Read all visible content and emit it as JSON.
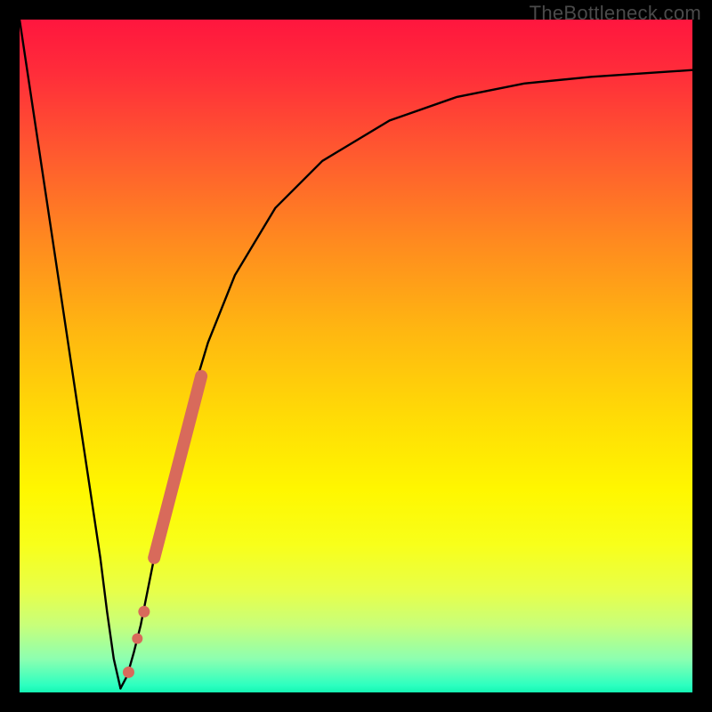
{
  "watermark": "TheBottleneck.com",
  "colors": {
    "frame": "#000000",
    "curve": "#000000",
    "marker": "#d86a5b"
  },
  "chart_data": {
    "type": "line",
    "title": "",
    "xlabel": "",
    "ylabel": "",
    "xlim": [
      0,
      100
    ],
    "ylim": [
      0,
      100
    ],
    "series": [
      {
        "name": "left-branch",
        "x": [
          0,
          3,
          6,
          9,
          10.5,
          12,
          13,
          14,
          15
        ],
        "y": [
          100,
          80,
          60,
          40,
          30,
          20,
          12,
          5,
          0.6
        ]
      },
      {
        "name": "right-branch",
        "x": [
          15,
          16,
          17,
          18,
          20,
          22,
          25,
          28,
          32,
          38,
          45,
          55,
          65,
          75,
          85,
          100
        ],
        "y": [
          0.6,
          2.5,
          6,
          10,
          20,
          30,
          42,
          52,
          62,
          72,
          79,
          85,
          88.5,
          90.5,
          91.5,
          92.5
        ]
      }
    ],
    "markers": [
      {
        "name": "segment",
        "x0": 20,
        "y0": 20,
        "x1": 27,
        "y1": 47
      },
      {
        "name": "dot1",
        "x": 18.5,
        "y": 12
      },
      {
        "name": "dot2",
        "x": 17.5,
        "y": 8
      },
      {
        "name": "dot3",
        "x": 16.2,
        "y": 3
      }
    ]
  }
}
